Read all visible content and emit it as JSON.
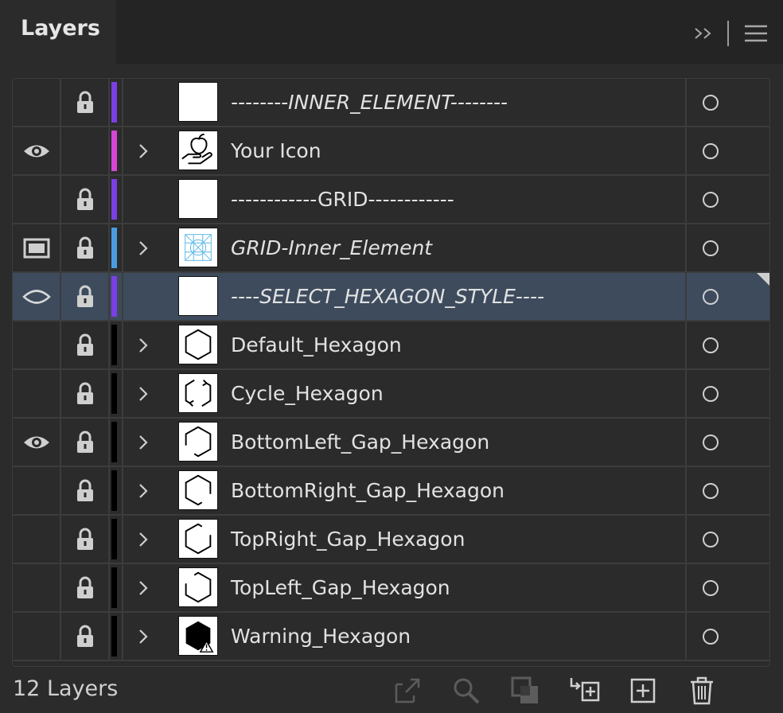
{
  "panel": {
    "tab_label": "Layers",
    "actions": [
      "collapse-icon",
      "panel-menu-icon"
    ]
  },
  "layers": [
    {
      "name": "--------INNER_ELEMENT--------",
      "italic": true,
      "visible": false,
      "visibility_icon": "",
      "locked": true,
      "color": "#7b3fe4",
      "has_children": false,
      "thumb": "blank",
      "selected": false
    },
    {
      "name": "Your Icon",
      "italic": false,
      "visible": true,
      "visibility_icon": "eye-icon",
      "locked": false,
      "color": "#d646d6",
      "has_children": true,
      "thumb": "apple-hand",
      "selected": false
    },
    {
      "name": "------------GRID------------",
      "italic": false,
      "visible": false,
      "visibility_icon": "",
      "locked": true,
      "color": "#7b3fe4",
      "has_children": false,
      "thumb": "blank",
      "selected": false
    },
    {
      "name": "GRID-Inner_Element",
      "italic": true,
      "visible": true,
      "visibility_icon": "template-icon",
      "locked": true,
      "color": "#4a9be0",
      "has_children": true,
      "thumb": "grid",
      "selected": false
    },
    {
      "name": "----SELECT_HEXAGON_STYLE----",
      "italic": true,
      "visible": true,
      "visibility_icon": "eye-outline-icon",
      "locked": true,
      "color": "#7b3fe4",
      "has_children": false,
      "thumb": "blank",
      "selected": true
    },
    {
      "name": "Default_Hexagon",
      "italic": false,
      "visible": false,
      "visibility_icon": "",
      "locked": true,
      "color": "#000000",
      "has_children": true,
      "thumb": "hexagon",
      "selected": false
    },
    {
      "name": "Cycle_Hexagon",
      "italic": false,
      "visible": false,
      "visibility_icon": "",
      "locked": true,
      "color": "#000000",
      "has_children": true,
      "thumb": "hexagon-cycle",
      "selected": false
    },
    {
      "name": "BottomLeft_Gap_Hexagon",
      "italic": false,
      "visible": true,
      "visibility_icon": "eye-icon",
      "locked": true,
      "color": "#000000",
      "has_children": true,
      "thumb": "hexagon-gap-bl",
      "selected": false
    },
    {
      "name": "BottomRight_Gap_Hexagon",
      "italic": false,
      "visible": false,
      "visibility_icon": "",
      "locked": true,
      "color": "#000000",
      "has_children": true,
      "thumb": "hexagon-gap-br",
      "selected": false
    },
    {
      "name": "TopRight_Gap_Hexagon",
      "italic": false,
      "visible": false,
      "visibility_icon": "",
      "locked": true,
      "color": "#000000",
      "has_children": true,
      "thumb": "hexagon-gap-tr",
      "selected": false
    },
    {
      "name": "TopLeft_Gap_Hexagon",
      "italic": false,
      "visible": false,
      "visibility_icon": "",
      "locked": true,
      "color": "#000000",
      "has_children": true,
      "thumb": "hexagon-gap-tl",
      "selected": false
    },
    {
      "name": "Warning_Hexagon",
      "italic": false,
      "visible": false,
      "visibility_icon": "",
      "locked": true,
      "color": "#000000",
      "has_children": true,
      "thumb": "hexagon-warning",
      "selected": false
    }
  ],
  "footer": {
    "layer_count": "12 Layers",
    "tools": [
      "export-icon",
      "search-icon",
      "clip-mask-icon",
      "new-sublayer-icon",
      "new-layer-icon",
      "trash-icon"
    ]
  },
  "colors": {
    "background": "#2b2b2b",
    "selected_row": "#3d4b5d"
  }
}
